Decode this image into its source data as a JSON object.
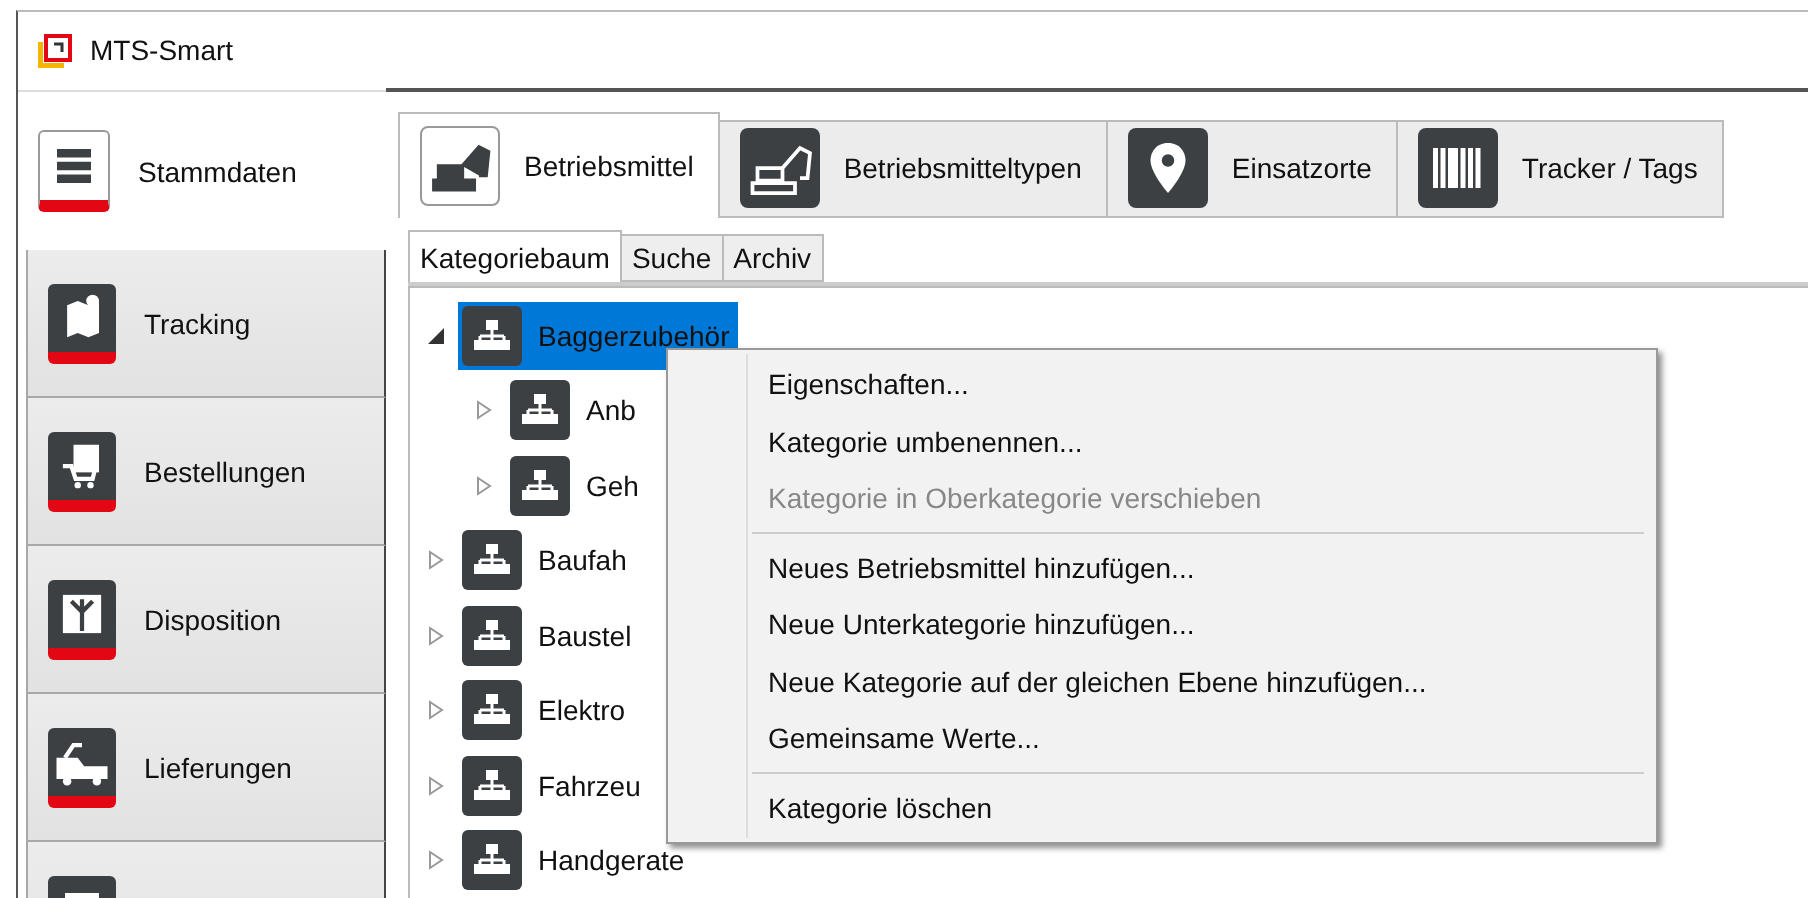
{
  "window": {
    "title": "MTS-Smart"
  },
  "sidebar": {
    "items": [
      {
        "label": "Stammdaten",
        "selected": true
      },
      {
        "label": "Tracking",
        "selected": false
      },
      {
        "label": "Bestellungen",
        "selected": false
      },
      {
        "label": "Disposition",
        "selected": false
      },
      {
        "label": "Lieferungen",
        "selected": false
      },
      {
        "selected": false
      }
    ]
  },
  "tabs": [
    {
      "label": "Betriebsmittel",
      "selected": true
    },
    {
      "label": "Betriebsmitteltypen",
      "selected": false
    },
    {
      "label": "Einsatzorte",
      "selected": false
    },
    {
      "label": "Tracker / Tags",
      "selected": false
    }
  ],
  "subtabs": [
    {
      "label": "Kategoriebaum",
      "selected": true
    },
    {
      "label": "Suche",
      "selected": false
    },
    {
      "label": "Archiv",
      "selected": false
    }
  ],
  "tree": [
    {
      "label": "Baggerzubehör",
      "expanded": true,
      "selected": true,
      "children": [
        {
          "label": "Anb",
          "expanded": false,
          "selected": false
        },
        {
          "label": "Geh",
          "expanded": false,
          "selected": false
        }
      ]
    },
    {
      "label": "Baufah",
      "expanded": false,
      "selected": false
    },
    {
      "label": "Baustel",
      "expanded": false,
      "selected": false
    },
    {
      "label": "Elektro",
      "expanded": false,
      "selected": false
    },
    {
      "label": "Fahrzeu",
      "expanded": false,
      "selected": false
    },
    {
      "label": "Handgerate",
      "expanded": false,
      "selected": false
    }
  ],
  "context_menu": [
    {
      "kind": "item",
      "label": "Eigenschaften...",
      "disabled": false
    },
    {
      "kind": "item",
      "label": "Kategorie umbenennen...",
      "disabled": false
    },
    {
      "kind": "item",
      "label": "Kategorie in Oberkategorie verschieben",
      "disabled": true
    },
    {
      "kind": "separator"
    },
    {
      "kind": "item",
      "label": "Neues Betriebsmittel hinzufügen...",
      "disabled": false
    },
    {
      "kind": "item",
      "label": "Neue Unterkategorie hinzufügen...",
      "disabled": false
    },
    {
      "kind": "item",
      "label": "Neue Kategorie auf der gleichen Ebene hinzufügen...",
      "disabled": false
    },
    {
      "kind": "item",
      "label": "Gemeinsame Werte...",
      "disabled": false
    },
    {
      "kind": "separator"
    },
    {
      "kind": "item",
      "label": "Kategorie löschen",
      "disabled": false
    }
  ]
}
